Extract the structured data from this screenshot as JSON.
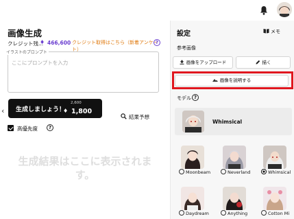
{
  "header": {
    "bell_icon": "bell-icon",
    "avatar_icon": "user-avatar"
  },
  "left": {
    "title": "画像生成",
    "credit_label": "クレジット残...",
    "credit_value": "466,600",
    "credit_link": "クレジット取得はこちら（新着アンケート）",
    "help_mark": "?",
    "prompt_label": "イラストのプロンプト",
    "prompt_placeholder": "ここにプロンプトを入力",
    "predict_label": "結果予想",
    "nav_left": "‹",
    "generate_label": "生成しましょう！",
    "generate_original": "2,600",
    "generate_cost": "1,800",
    "hq_label": "高優先度",
    "empty_message": "生成結果はここに表示されます。"
  },
  "right": {
    "settings_title": "設定",
    "memo_label": "メモ",
    "reference_label": "参考画像",
    "upload_label": "画像をアップロード",
    "draw_label": "描く",
    "describe_label": "画像を説明する",
    "model_label": "モデル",
    "selected_model": "Whimsical",
    "models": [
      {
        "name": "Moonbeam",
        "selected": false
      },
      {
        "name": "Neverland",
        "selected": false
      },
      {
        "name": "Whimsical",
        "selected": true
      },
      {
        "name": "Daydream",
        "selected": false
      },
      {
        "name": "Anything",
        "selected": false
      },
      {
        "name": "Cotton Mi",
        "selected": false
      }
    ]
  },
  "colors": {
    "accent_purple": "#6b3fd0",
    "link_orange": "#e07b10",
    "highlight_red": "#e0171f",
    "button_dark": "#111111"
  }
}
